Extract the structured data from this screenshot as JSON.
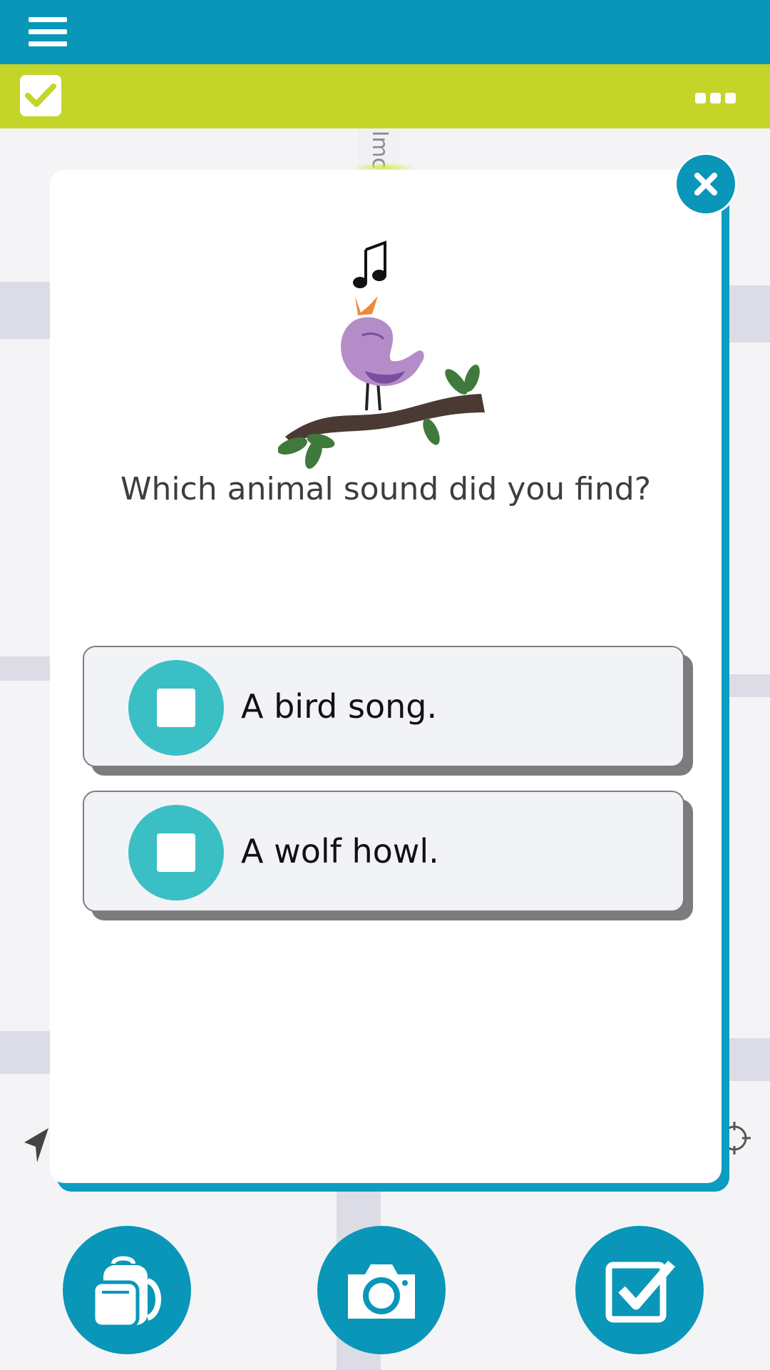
{
  "map": {
    "street_label": "Imc"
  },
  "modal": {
    "question": "Which animal sound did you find?",
    "answers": [
      {
        "label": "A bird song."
      },
      {
        "label": "A wolf howl."
      }
    ]
  },
  "icons": {
    "menu": "hamburger-menu-icon",
    "task": "checkbox-icon",
    "more": "more-dots-icon",
    "close": "close-icon",
    "illustration": "singing-bird-illustration",
    "navigate": "navigation-arrow-icon",
    "locate": "crosshair-icon",
    "backpack": "backpack-icon",
    "camera": "camera-icon",
    "tasks": "checkbox-icon"
  },
  "colors": {
    "topbar": "#0996b9",
    "taskbar": "#c5d428",
    "answer_badge": "#3abfc4",
    "modal_border": "#0c9cc1"
  }
}
